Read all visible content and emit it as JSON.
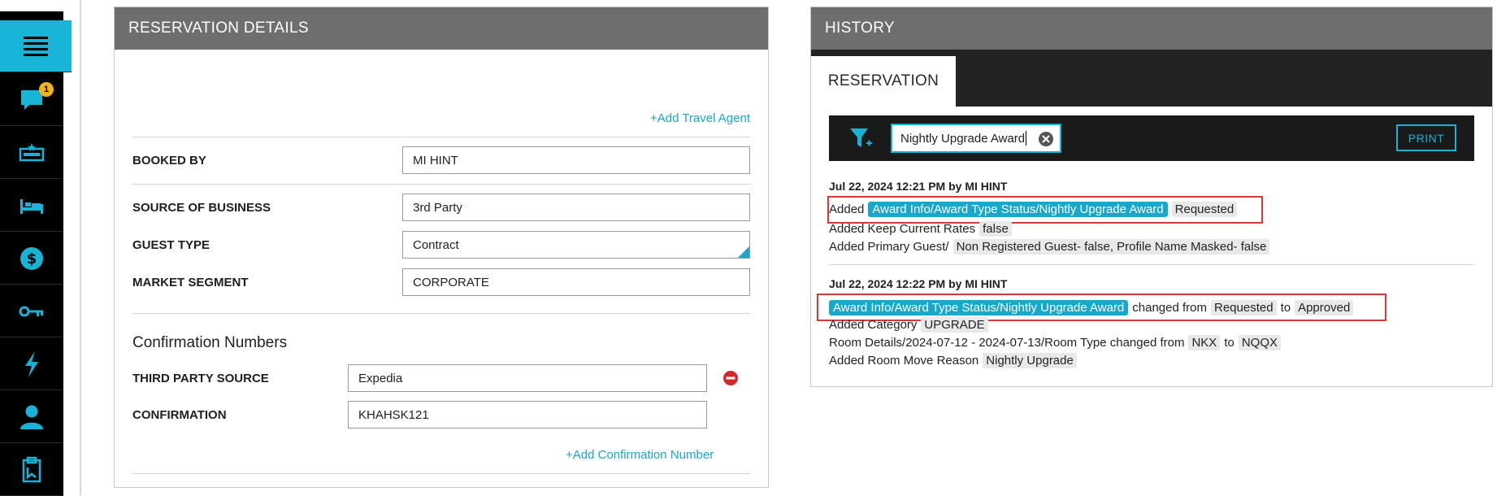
{
  "rail": {
    "chat_badge": "1"
  },
  "reservation": {
    "title": "RESERVATION DETAILS",
    "add_travel_agent": "+Add Travel Agent",
    "booked_by_label": "BOOKED BY",
    "booked_by_value": "MI HINT",
    "source_label": "SOURCE OF BUSINESS",
    "source_value": "3rd Party",
    "guest_type_label": "GUEST TYPE",
    "guest_type_value": "Contract",
    "market_label": "MARKET SEGMENT",
    "market_value": "CORPORATE",
    "confirmation_title": "Confirmation Numbers",
    "third_party_label": "THIRD PARTY SOURCE",
    "third_party_value": "Expedia",
    "confirmation_label": "CONFIRMATION",
    "confirmation_value": "KHAHSK121",
    "add_confirmation": "+Add Confirmation Number"
  },
  "history": {
    "title": "HISTORY",
    "tab": "RESERVATION",
    "filter_value": "Nightly Upgrade Award",
    "print": "PRINT",
    "entries": [
      {
        "head": "Jul 22, 2024 12:21 PM by MI HINT",
        "l1_added": "Added",
        "l1_highlight": "Award Info/Award Type Status/Nightly Upgrade Award",
        "l1_value": "Requested",
        "l2_text": "Added Keep Current Rates",
        "l2_value": "false",
        "l3_text": "Added Primary Guest/",
        "l3_value": "Non Registered Guest- false, Profile Name Masked- false"
      },
      {
        "head": "Jul 22, 2024 12:22 PM by MI HINT",
        "l1_highlight": "Award Info/Award Type Status/Nightly Upgrade Award",
        "l1_changed": "changed from",
        "l1_from": "Requested",
        "l1_to": "to",
        "l1_value": "Approved",
        "l2_text": "Added Category",
        "l2_value": "UPGRADE",
        "l3_text": "Room Details/2024-07-12 - 2024-07-13/Room Type changed from",
        "l3_from": "NKX",
        "l3_to": "to",
        "l3_value": "NQQX",
        "l4_text": "Added Room Move Reason",
        "l4_value": "Nightly Upgrade"
      }
    ]
  }
}
